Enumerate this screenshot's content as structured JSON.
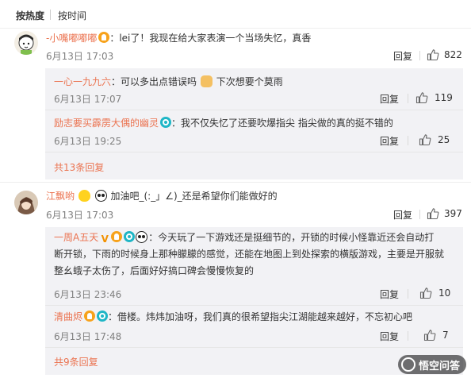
{
  "sort": {
    "hot": "按热度",
    "time": "按时间"
  },
  "comments": [
    {
      "user": "-小嘴嘟嘟嘟",
      "text": "：lei了！我现在给大家表演一个当场失忆，真香",
      "time": "6月13日 17:03",
      "reply": "回复",
      "likes": "822",
      "replies": [
        {
          "user": "一心一九九六",
          "text_a": "：可以多出点错误吗",
          "text_b": "下次想要个莫雨",
          "time": "6月13日 17:07",
          "reply": "回复",
          "likes": "119"
        },
        {
          "user": "励志要买霹雳大偶的幽灵",
          "text": "：我不仅失忆了还要吹爆指尖  指尖做的真的挺不错的",
          "time": "6月13日 19:25",
          "reply": "回复",
          "likes": "25"
        }
      ],
      "more": "共13条回复"
    },
    {
      "user": "江飘哟",
      "text_a": "加油吧_(:_」∠)_还是希望你们能做好的",
      "time": "6月13日 17:03",
      "reply": "回复",
      "likes": "397",
      "replies": [
        {
          "user": "一周A五天",
          "line1": "：今天玩了一下游戏还是挺细节的，开锁的时候小怪靠近还会自动打",
          "line2": "断开锁，下雨的时候身上那种朦朦的感觉，还能在地图上到处探索的横版游戏，主要是开服就",
          "line3": "整幺蛾子太伤了，后面好好搞口碑会慢慢恢复的",
          "time": "6月13日 23:46",
          "reply": "回复",
          "likes": "10"
        },
        {
          "user": "清曲烬",
          "text": "：借楼。炜炜加油呀，我们真的很希望指尖江湖能越来越好，不忘初心吧",
          "time": "6月13日 17:48",
          "reply": "回复",
          "likes": "7"
        }
      ],
      "more": "共9条回复"
    }
  ],
  "watermark": "悟空问答",
  "colors": {
    "link": "#eb7350",
    "meta": "#808080",
    "reply_bg": "#f2f2f5"
  }
}
